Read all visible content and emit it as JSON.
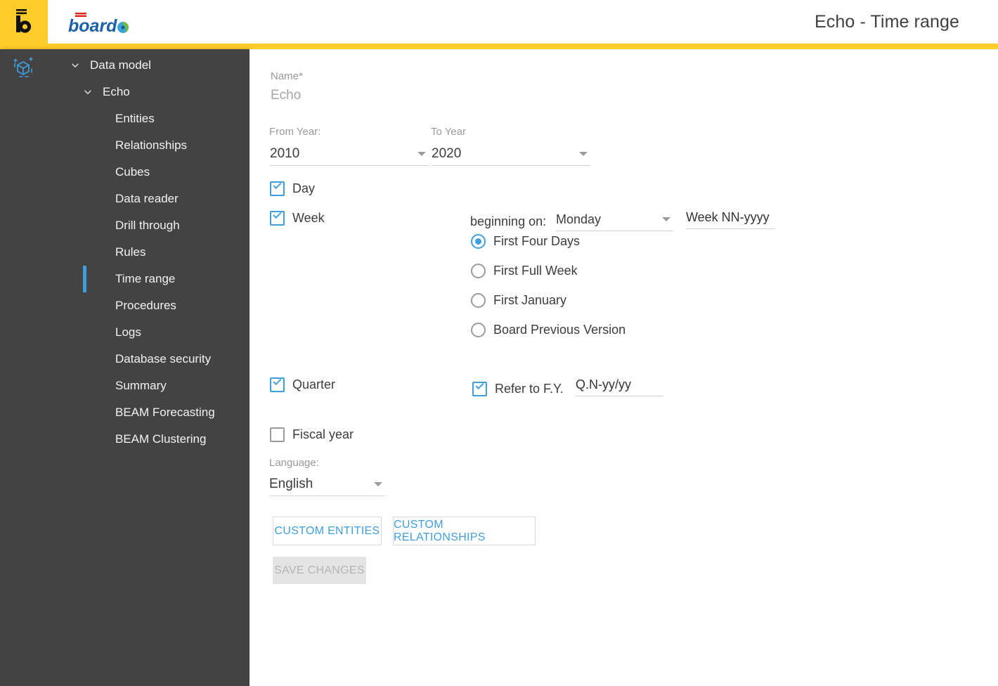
{
  "header": {
    "title": "Echo - Time range",
    "brand_name": "board",
    "app_icon": "board-b-logo-icon",
    "accent_yellow": "#ffcc29",
    "brand_blue": "#1a5fa8"
  },
  "sidebar": {
    "logo_icon": "data-model-cube-icon",
    "background": "#434343",
    "active_indicator_color": "#3f9ede",
    "items": [
      {
        "label": "Data model",
        "level": 0,
        "expanded": true,
        "active": false,
        "chevron": "chevron-down-icon"
      },
      {
        "label": "Echo",
        "level": 1,
        "expanded": true,
        "active": false,
        "chevron": "chevron-down-icon"
      },
      {
        "label": "Entities",
        "level": 2,
        "expanded": null,
        "active": false,
        "chevron": ""
      },
      {
        "label": "Relationships",
        "level": 2,
        "expanded": null,
        "active": false,
        "chevron": ""
      },
      {
        "label": "Cubes",
        "level": 2,
        "expanded": null,
        "active": false,
        "chevron": ""
      },
      {
        "label": "Data reader",
        "level": 2,
        "expanded": null,
        "active": false,
        "chevron": ""
      },
      {
        "label": "Drill through",
        "level": 2,
        "expanded": null,
        "active": false,
        "chevron": ""
      },
      {
        "label": "Rules",
        "level": 2,
        "expanded": null,
        "active": false,
        "chevron": ""
      },
      {
        "label": "Time range",
        "level": 2,
        "expanded": null,
        "active": true,
        "chevron": ""
      },
      {
        "label": "Procedures",
        "level": 2,
        "expanded": null,
        "active": false,
        "chevron": ""
      },
      {
        "label": "Logs",
        "level": 2,
        "expanded": null,
        "active": false,
        "chevron": ""
      },
      {
        "label": "Database security",
        "level": 2,
        "expanded": null,
        "active": false,
        "chevron": ""
      },
      {
        "label": "Summary",
        "level": 2,
        "expanded": null,
        "active": false,
        "chevron": ""
      },
      {
        "label": "BEAM Forecasting",
        "level": 2,
        "expanded": null,
        "active": false,
        "chevron": ""
      },
      {
        "label": "BEAM Clustering",
        "level": 2,
        "expanded": null,
        "active": false,
        "chevron": ""
      }
    ]
  },
  "form": {
    "name": {
      "label": "Name",
      "required_marker": "*",
      "value": "Echo"
    },
    "from_year": {
      "label": "From Year:",
      "value": "2010"
    },
    "to_year": {
      "label": "To Year",
      "value": "2020"
    },
    "day": {
      "label": "Day",
      "checked": true
    },
    "week": {
      "label": "Week",
      "checked": true,
      "beginning_on_label": "beginning on:",
      "beginning_on_value": "Monday",
      "format_value": "Week NN-yyyy",
      "options": [
        {
          "label": "First Four Days",
          "selected": true
        },
        {
          "label": "First Full Week",
          "selected": false
        },
        {
          "label": "First January",
          "selected": false
        },
        {
          "label": "Board Previous Version",
          "selected": false
        }
      ]
    },
    "quarter": {
      "label": "Quarter",
      "checked": true,
      "refer_fy_label": "Refer to F.Y.",
      "refer_fy_checked": true,
      "format_value": "Q.N-yy/yy"
    },
    "fiscal_year": {
      "label": "Fiscal year",
      "checked": false
    },
    "language": {
      "label": "Language:",
      "value": "English"
    },
    "buttons": {
      "custom_entities": "CUSTOM ENTITIES",
      "custom_relationships": "CUSTOM RELATIONSHIPS",
      "save_changes": "SAVE CHANGES",
      "save_disabled": true
    }
  }
}
